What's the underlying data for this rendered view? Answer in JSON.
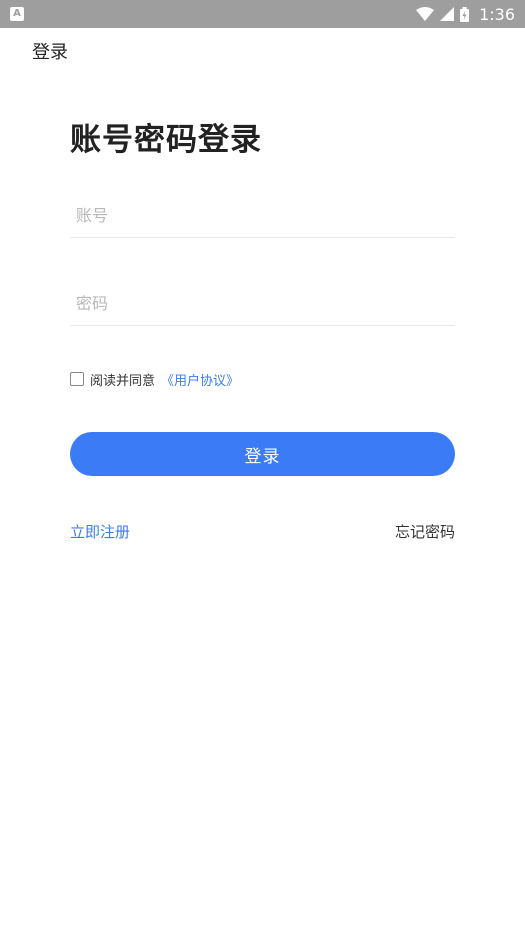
{
  "status_bar": {
    "notification_icon_text": "A",
    "time": "1:36",
    "icons": [
      "wifi-icon",
      "cell-signal-icon",
      "battery-icon"
    ]
  },
  "app_bar": {
    "title": "登录"
  },
  "page": {
    "title": "账号密码登录"
  },
  "form": {
    "account_placeholder": "账号",
    "account_value": "",
    "password_placeholder": "密码",
    "password_value": "",
    "agree_checked": false,
    "agree_text": "阅读并同意",
    "agreement_link": "《用户协议》",
    "login_button": "登录"
  },
  "links": {
    "register": "立即注册",
    "forgot_password": "忘记密码"
  },
  "colors": {
    "status_bar": "#9e9e9e",
    "accent": "#3b7cf6",
    "text": "#222222"
  }
}
